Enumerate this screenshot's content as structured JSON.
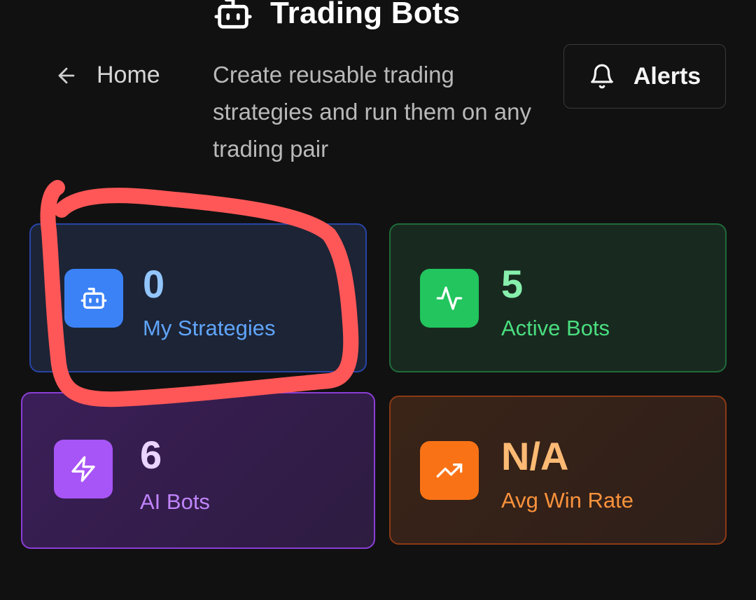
{
  "header": {
    "title": "Trading Bots",
    "title_icon": "robot-icon",
    "subtitle": "Create reusable trading strategies and run them on any trading pair"
  },
  "nav": {
    "back_label": "Home",
    "back_icon": "arrow-left-icon"
  },
  "alerts_button": {
    "label": "Alerts",
    "icon": "bell-icon"
  },
  "stats": [
    {
      "value": "0",
      "label": "My Strategies",
      "icon": "robot-icon",
      "accent": "#3b82f6"
    },
    {
      "value": "5",
      "label": "Active Bots",
      "icon": "activity-icon",
      "accent": "#22c55e"
    },
    {
      "value": "6",
      "label": "AI Bots",
      "icon": "lightning-icon",
      "accent": "#a855f7"
    },
    {
      "value": "N/A",
      "label": "Avg Win Rate",
      "icon": "trending-up-icon",
      "accent": "#f97316"
    }
  ],
  "annotation": {
    "type": "freehand-circle",
    "color": "#ff4d4d",
    "target": "My Strategies"
  }
}
